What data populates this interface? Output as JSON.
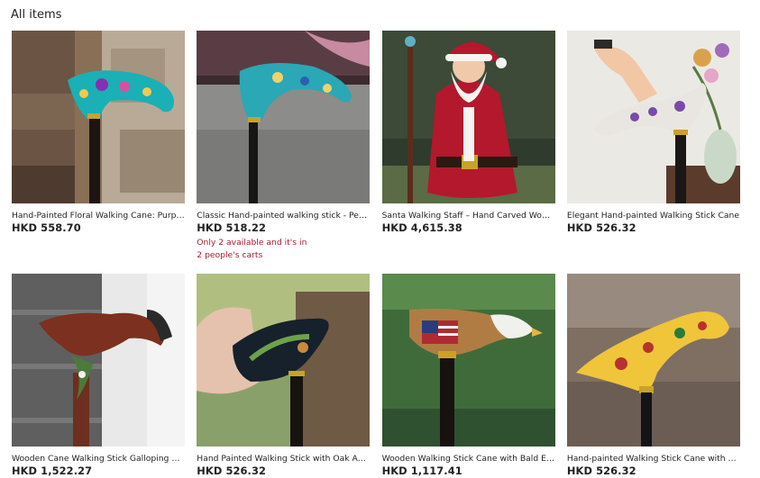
{
  "section": {
    "title": "All items"
  },
  "items": [
    {
      "title": "Hand-Painted Floral Walking Cane: Purple & Teal",
      "price": "HKD 558.70",
      "image_icon": "floral-teal-cane-photo"
    },
    {
      "title": "Classic Hand-painted walking stick - Peacock",
      "price": "HKD 518.22",
      "stock_line1": "Only 2 available and it's in",
      "stock_line2": "2 people's carts",
      "image_icon": "peacock-cane-photo"
    },
    {
      "title": "Santa Walking Staff – Hand Carved Wooden",
      "price": "HKD 4,615.38",
      "image_icon": "santa-staff-photo"
    },
    {
      "title": "Elegant Hand-painted Walking Stick Cane",
      "price": "HKD 526.32",
      "image_icon": "white-floral-cane-photo"
    },
    {
      "title": "Wooden Cane Walking Stick Galloping Horse",
      "price": "HKD 1,522.27",
      "image_icon": "horse-cane-photo"
    },
    {
      "title": "Hand Painted Walking Stick with Oak Acorn",
      "price": "HKD 526.32",
      "image_icon": "oak-cane-photo"
    },
    {
      "title": "Wooden Walking Stick Cane with Bald Eagle",
      "price": "HKD 1,117.41",
      "image_icon": "eagle-cane-photo"
    },
    {
      "title": "Hand-painted Walking Stick Cane with Flowers",
      "price": "HKD 526.32",
      "image_icon": "yellow-floral-cane-photo"
    }
  ]
}
